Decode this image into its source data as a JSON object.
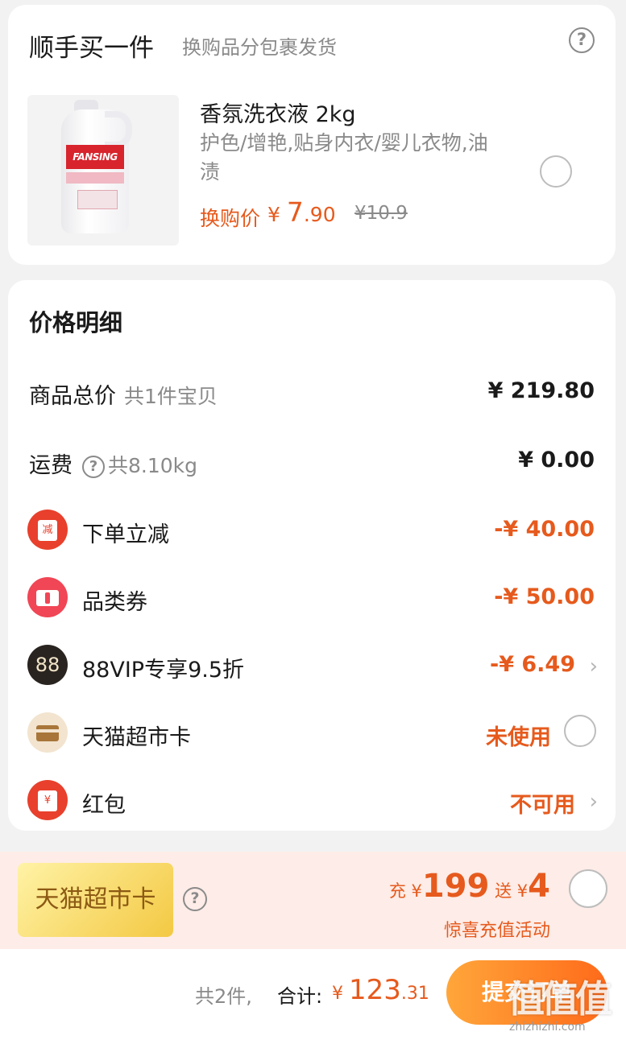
{
  "buy_one": {
    "title": "顺手买一件",
    "subtitle": "换购品分包裹发货",
    "product": {
      "name": "香氛洗衣液 2kg",
      "desc": "护色/增艳,贴身内衣/婴儿衣物,油渍",
      "swap_label": "换购价",
      "currency": "¥",
      "price_int": "7",
      "price_dec": ".90",
      "original_price": "¥10.9",
      "image_label": "FANSING",
      "selected": false
    }
  },
  "price_detail": {
    "title": "价格明细",
    "rows": [
      {
        "label": "商品总价",
        "note": "共1件宝贝",
        "value": "¥ 219.80"
      },
      {
        "label": "运费",
        "note": "共8.10kg",
        "value": "¥ 0.00"
      },
      {
        "label": "下单立减",
        "value": "-¥ 40.00",
        "icon_text": "减"
      },
      {
        "label": "品类券",
        "value": "-¥ 50.00"
      },
      {
        "label": "88VIP专享9.5折",
        "value": "-¥ 6.49",
        "icon_text": "88"
      },
      {
        "label": "天猫超市卡",
        "value": "未使用"
      },
      {
        "label": "红包",
        "value": "不可用",
        "icon_text": "¥"
      }
    ]
  },
  "promo": {
    "badge": "天猫超市卡",
    "charge_label": "充",
    "currency": "¥",
    "charge_amount": "199",
    "gift_label": "送",
    "gift_amount": "4",
    "subtitle": "惊喜充值活动"
  },
  "footer": {
    "count": "共2件,",
    "total_label": "合计:",
    "currency": "¥",
    "total_int": "123",
    "total_dec": ".31",
    "submit": "提交订单",
    "watermark": "值值值",
    "watermark_url": "zhizhizhi.com"
  },
  "colors": {
    "accent": "#e65a1d",
    "muted": "#8a8a8a",
    "background": "#f2f2f2"
  },
  "icons": [
    "help-circle-icon",
    "reduce-badge-icon",
    "ticket-icon",
    "vip-88-icon",
    "card-icon",
    "red-packet-icon",
    "chevron-right-icon"
  ]
}
